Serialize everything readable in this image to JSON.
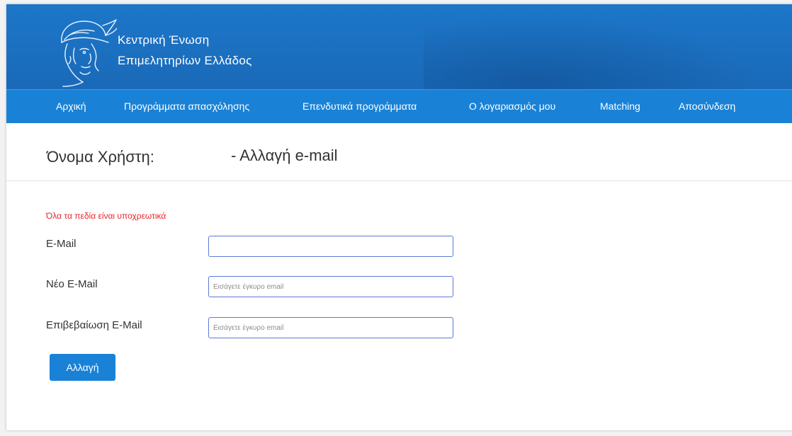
{
  "header": {
    "org_name_line1": "Κεντρική Ένωση",
    "org_name_line2": "Επιμελητηρίων Ελλάδος",
    "logo_icon": "hermes-head-icon"
  },
  "nav": {
    "items": [
      {
        "label": "Αρχική"
      },
      {
        "label": "Προγράμματα απασχόλησης"
      },
      {
        "label": "Επενδυτικά προγράμματα"
      },
      {
        "label": "Ο λογαριασμός μου"
      },
      {
        "label": "Matching"
      },
      {
        "label": "Αποσύνδεση"
      }
    ]
  },
  "page": {
    "title_label": "Όνομα Χρήστη:",
    "title_action": "- Αλλαγή e-mail",
    "required_note": "Όλα τα πεδία είναι υποχρεωτικά"
  },
  "form": {
    "email": {
      "label": "E-Mail",
      "value": "",
      "placeholder": ""
    },
    "new_email": {
      "label": "Νέο E-Mail",
      "value": "",
      "placeholder": "Εισάγετε έγκυρο email"
    },
    "confirm_email": {
      "label": "Επιβεβαίωση E-Mail",
      "value": "",
      "placeholder": "Εισάγετε έγκυρο email"
    },
    "submit_label": "Αλλαγή"
  },
  "colors": {
    "banner": "#1d76c9",
    "navbar": "#1a82d6",
    "button": "#1a82d6",
    "required_text": "#e8242b",
    "input_border": "#5b7bd6"
  }
}
